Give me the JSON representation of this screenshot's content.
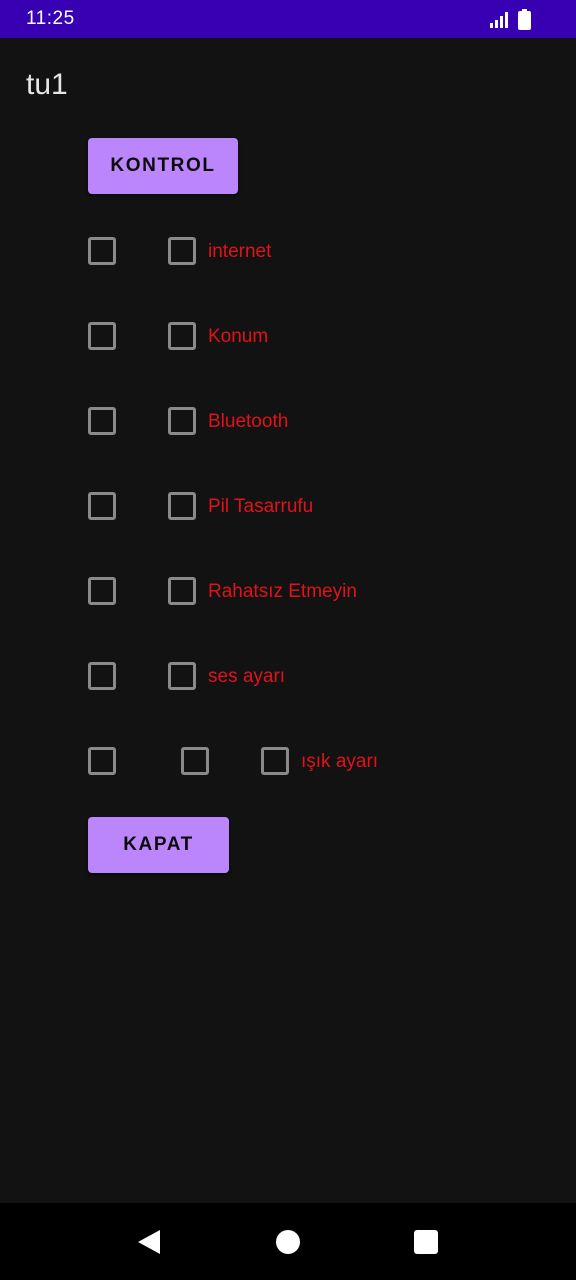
{
  "status_bar": {
    "time": "11:25",
    "icons": [
      "signal-icon",
      "battery-icon"
    ],
    "background": "#3700b3"
  },
  "app": {
    "title": "tu1"
  },
  "buttons": {
    "kontrol": "KONTROL",
    "kapat": "KAPAT",
    "color": "#bb86fc"
  },
  "settings": [
    {
      "label": "internet",
      "checked_left": false,
      "checked_right": false
    },
    {
      "label": "Konum",
      "checked_left": false,
      "checked_right": false
    },
    {
      "label": "Bluetooth",
      "checked_left": false,
      "checked_right": false
    },
    {
      "label": "Pil Tasarrufu",
      "checked_left": false,
      "checked_right": false
    },
    {
      "label": "Rahatsız Etmeyin",
      "checked_left": false,
      "checked_right": false
    },
    {
      "label": "ses ayarı",
      "checked_left": false,
      "checked_right": false
    },
    {
      "label": "ışık ayarı",
      "checked_left": false,
      "checked_middle": false,
      "checked_right": false
    }
  ],
  "label_color": "#e0131a",
  "nav_bar": {
    "icons": [
      "back-icon",
      "home-icon",
      "recents-icon"
    ]
  }
}
